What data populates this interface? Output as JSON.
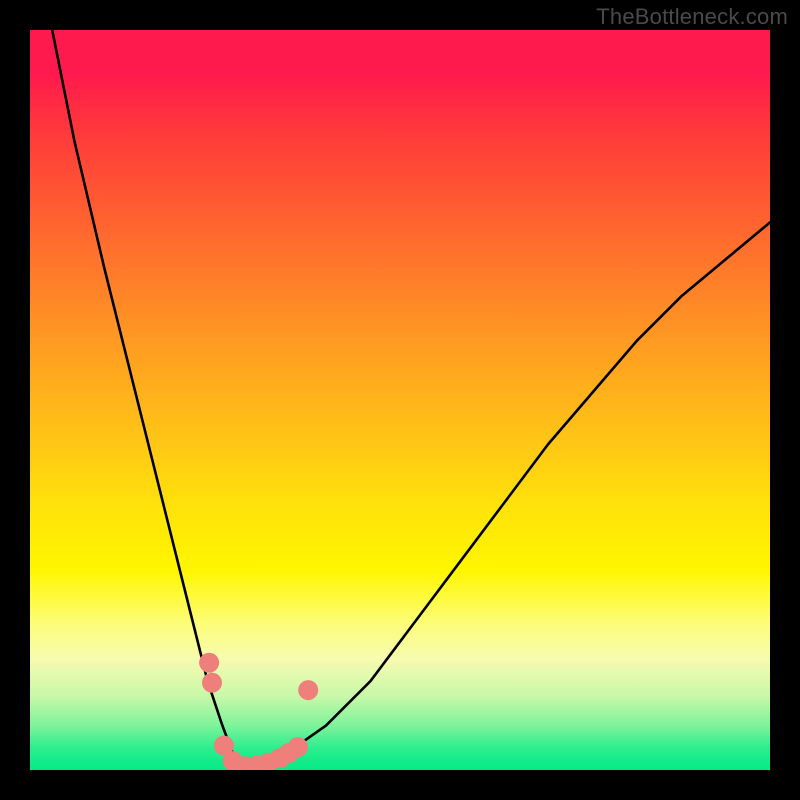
{
  "watermark": "TheBottleneck.com",
  "chart_data": {
    "type": "line",
    "title": "",
    "xlabel": "",
    "ylabel": "",
    "xlim": [
      0,
      100
    ],
    "ylim": [
      0,
      100
    ],
    "grid": false,
    "legend": false,
    "note": "Axes are unlabeled in the source image; values are relative coordinates 0–100 estimated from pixel positions.",
    "series": [
      {
        "name": "curve",
        "color": "#000000",
        "x": [
          3,
          6,
          10,
          14,
          18,
          22,
          24,
          26,
          27.5,
          29,
          31,
          33,
          35,
          40,
          46,
          52,
          58,
          64,
          70,
          76,
          82,
          88,
          94,
          100
        ],
        "y": [
          100,
          85,
          68,
          52,
          36,
          20,
          12,
          6,
          2,
          0,
          0,
          1,
          2.5,
          6,
          12,
          20,
          28,
          36,
          44,
          51,
          58,
          64,
          69,
          74
        ]
      }
    ],
    "markers": [
      {
        "name": "pink-dots",
        "color": "#ef7f7a",
        "shape": "circle",
        "radius_px": 10,
        "points": [
          {
            "x": 24.2,
            "y": 14.5
          },
          {
            "x": 24.6,
            "y": 11.8
          },
          {
            "x": 26.2,
            "y": 3.3
          },
          {
            "x": 27.4,
            "y": 1.2
          },
          {
            "x": 29.0,
            "y": 0.5
          },
          {
            "x": 30.6,
            "y": 0.6
          },
          {
            "x": 32.2,
            "y": 1.0
          },
          {
            "x": 33.8,
            "y": 1.6
          },
          {
            "x": 35.0,
            "y": 2.3
          },
          {
            "x": 36.2,
            "y": 3.1
          },
          {
            "x": 37.6,
            "y": 10.8
          }
        ]
      }
    ]
  }
}
